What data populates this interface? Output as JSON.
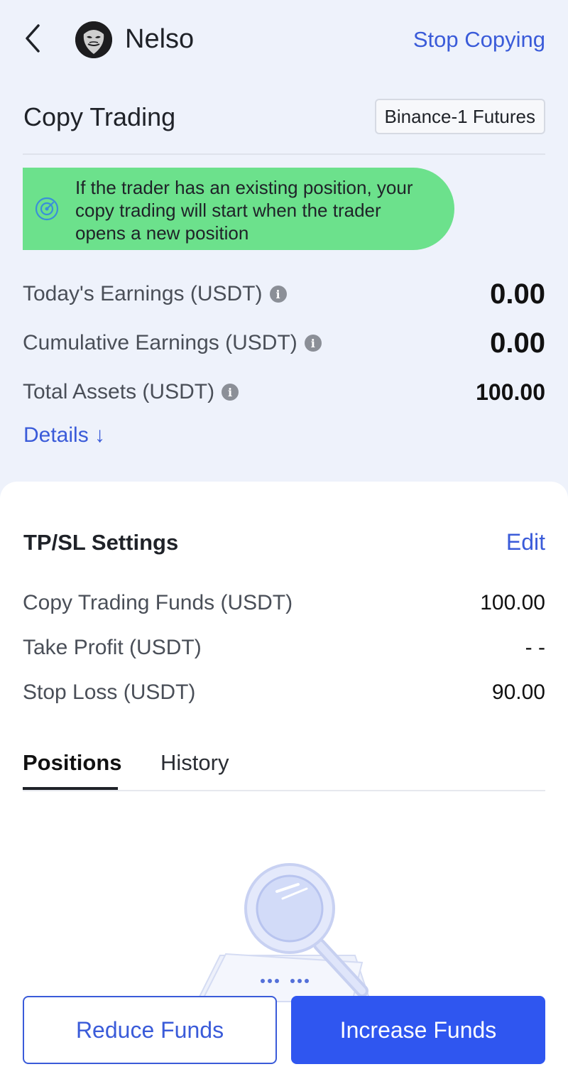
{
  "header": {
    "trader_name": "Nelso",
    "stop_copying": "Stop Copying"
  },
  "copy_trading": {
    "title": "Copy Trading",
    "exchange": "Binance-1 Futures",
    "notice": "If the trader has an existing position, your copy trading will start when the trader opens a new position"
  },
  "stats": [
    {
      "label": "Today's Earnings  (USDT)",
      "value": "0.00"
    },
    {
      "label": "Cumulative Earnings  (USDT)",
      "value": "0.00"
    },
    {
      "label": "Total Assets  (USDT)",
      "value": "100.00"
    }
  ],
  "details_link": "Details ↓",
  "tpsl": {
    "title": "TP/SL Settings",
    "edit": "Edit",
    "rows": [
      {
        "label": "Copy Trading Funds (USDT)",
        "value": "100.00"
      },
      {
        "label": "Take Profit (USDT)",
        "value": "- -"
      },
      {
        "label": "Stop Loss (USDT)",
        "value": "90.00"
      }
    ]
  },
  "tabs": [
    {
      "label": "Positions",
      "active": true
    },
    {
      "label": "History",
      "active": false
    }
  ],
  "buttons": {
    "reduce": "Reduce Funds",
    "increase": "Increase Funds"
  },
  "colors": {
    "accent": "#3a5bd9",
    "primary_button": "#2f56f0",
    "notice_bg": "#6ce18c",
    "top_bg": "#eef2fb"
  },
  "icons": {
    "back": "chevron-left-icon",
    "notice": "target-icon",
    "info": "info-icon",
    "empty": "magnifier-icon"
  }
}
